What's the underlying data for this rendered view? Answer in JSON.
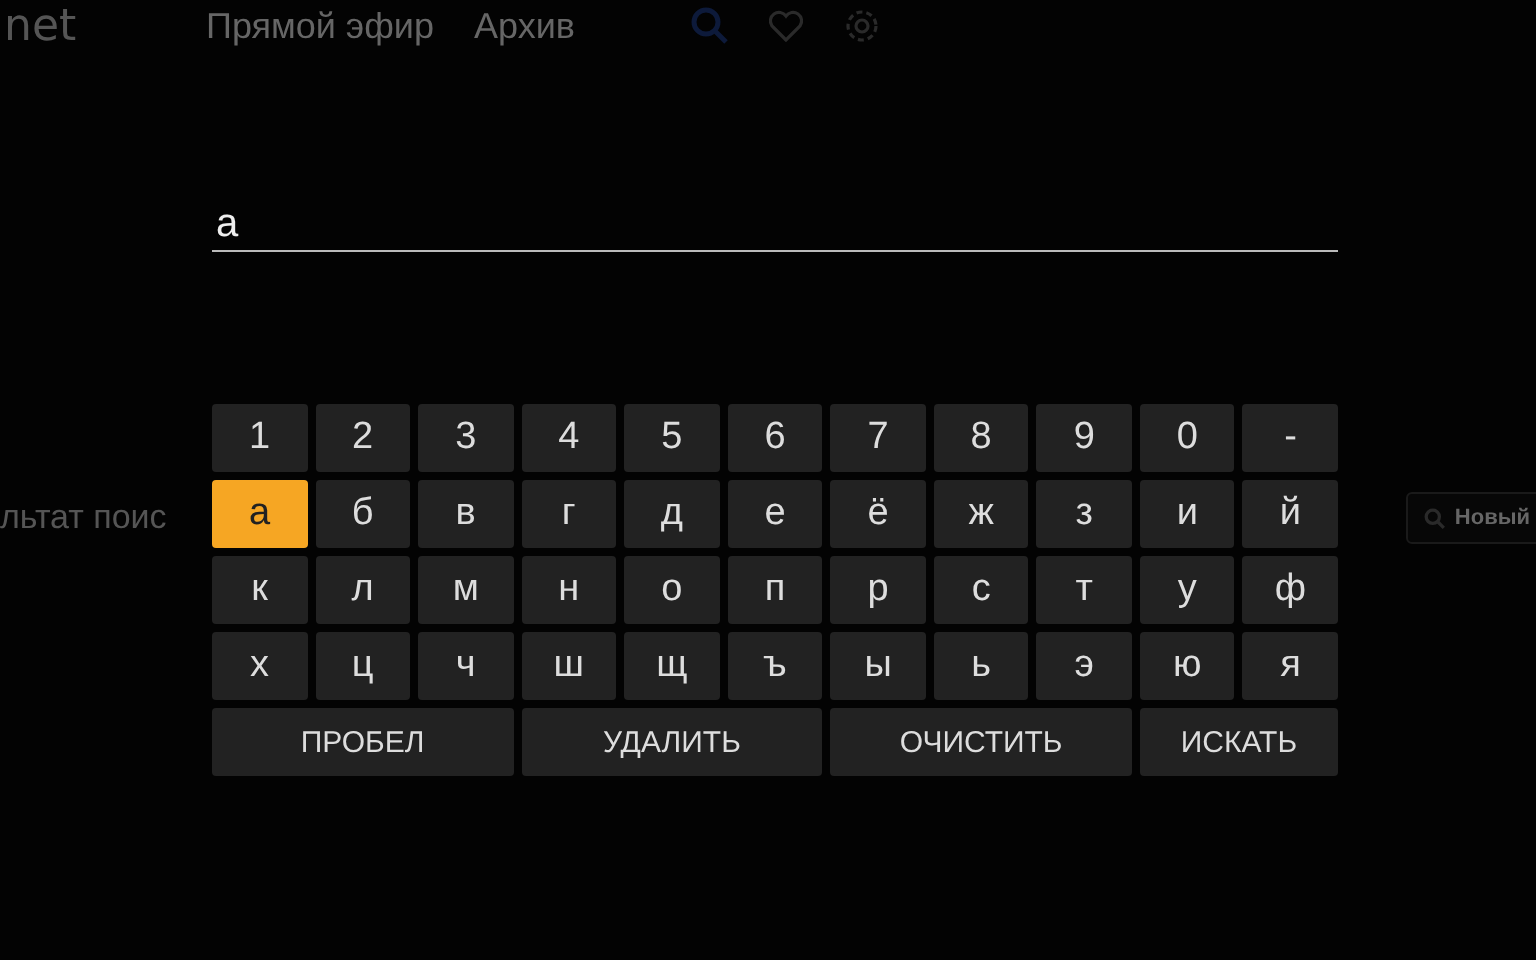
{
  "background": {
    "logo": "net",
    "nav": [
      {
        "label": "Прямой эфир"
      },
      {
        "label": "Архив"
      }
    ],
    "result_heading": "льтат поис",
    "new_button": "Новый"
  },
  "search": {
    "value": "а"
  },
  "keyboard": {
    "rows": [
      [
        {
          "label": "1",
          "selected": false
        },
        {
          "label": "2",
          "selected": false
        },
        {
          "label": "3",
          "selected": false
        },
        {
          "label": "4",
          "selected": false
        },
        {
          "label": "5",
          "selected": false
        },
        {
          "label": "6",
          "selected": false
        },
        {
          "label": "7",
          "selected": false
        },
        {
          "label": "8",
          "selected": false
        },
        {
          "label": "9",
          "selected": false
        },
        {
          "label": "0",
          "selected": false
        },
        {
          "label": "-",
          "selected": false
        }
      ],
      [
        {
          "label": "а",
          "selected": true
        },
        {
          "label": "б",
          "selected": false
        },
        {
          "label": "в",
          "selected": false
        },
        {
          "label": "г",
          "selected": false
        },
        {
          "label": "д",
          "selected": false
        },
        {
          "label": "е",
          "selected": false
        },
        {
          "label": "ё",
          "selected": false
        },
        {
          "label": "ж",
          "selected": false
        },
        {
          "label": "з",
          "selected": false
        },
        {
          "label": "и",
          "selected": false
        },
        {
          "label": "й",
          "selected": false
        }
      ],
      [
        {
          "label": "к",
          "selected": false
        },
        {
          "label": "л",
          "selected": false
        },
        {
          "label": "м",
          "selected": false
        },
        {
          "label": "н",
          "selected": false
        },
        {
          "label": "о",
          "selected": false
        },
        {
          "label": "п",
          "selected": false
        },
        {
          "label": "р",
          "selected": false
        },
        {
          "label": "с",
          "selected": false
        },
        {
          "label": "т",
          "selected": false
        },
        {
          "label": "у",
          "selected": false
        },
        {
          "label": "ф",
          "selected": false
        }
      ],
      [
        {
          "label": "х",
          "selected": false
        },
        {
          "label": "ц",
          "selected": false
        },
        {
          "label": "ч",
          "selected": false
        },
        {
          "label": "ш",
          "selected": false
        },
        {
          "label": "щ",
          "selected": false
        },
        {
          "label": "ъ",
          "selected": false
        },
        {
          "label": "ы",
          "selected": false
        },
        {
          "label": "ь",
          "selected": false
        },
        {
          "label": "э",
          "selected": false
        },
        {
          "label": "ю",
          "selected": false
        },
        {
          "label": "я",
          "selected": false
        }
      ]
    ],
    "actions": [
      {
        "label": "ПРОБЕЛ",
        "selected": false
      },
      {
        "label": "УДАЛИТЬ",
        "selected": false
      },
      {
        "label": "ОЧИСТИТЬ",
        "selected": false
      },
      {
        "label": "ИСКАТЬ",
        "selected": false
      }
    ]
  }
}
